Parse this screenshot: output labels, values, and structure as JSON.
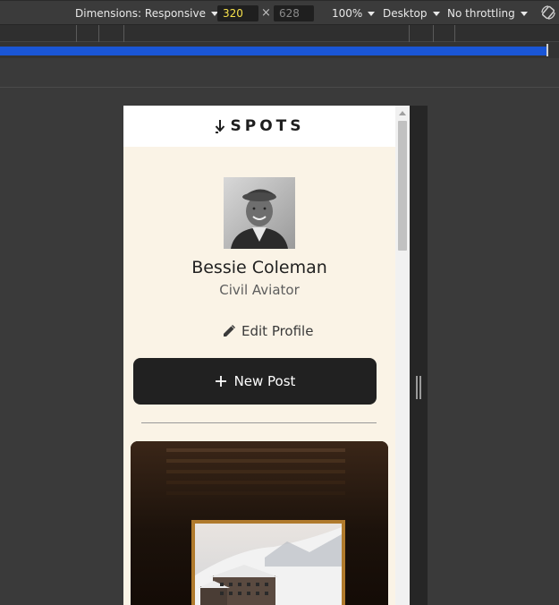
{
  "toolbar": {
    "dimensions_label": "Dimensions: Responsive",
    "width_value": "320",
    "height_value": "628",
    "times": "×",
    "zoom": "100%",
    "device_mode": "Desktop",
    "throttling": "No throttling",
    "icons": [
      "caret-down-icon",
      "rotate-icon"
    ]
  },
  "page": {
    "logo": "SPOTS",
    "profile": {
      "name": "Bessie Coleman",
      "title": "Civil Aviator",
      "edit_label": "Edit Profile"
    },
    "new_post_label": "New Post",
    "colors": {
      "background": "#faf3e6",
      "button": "#212121",
      "accent_blue": "#1a56d6"
    }
  }
}
